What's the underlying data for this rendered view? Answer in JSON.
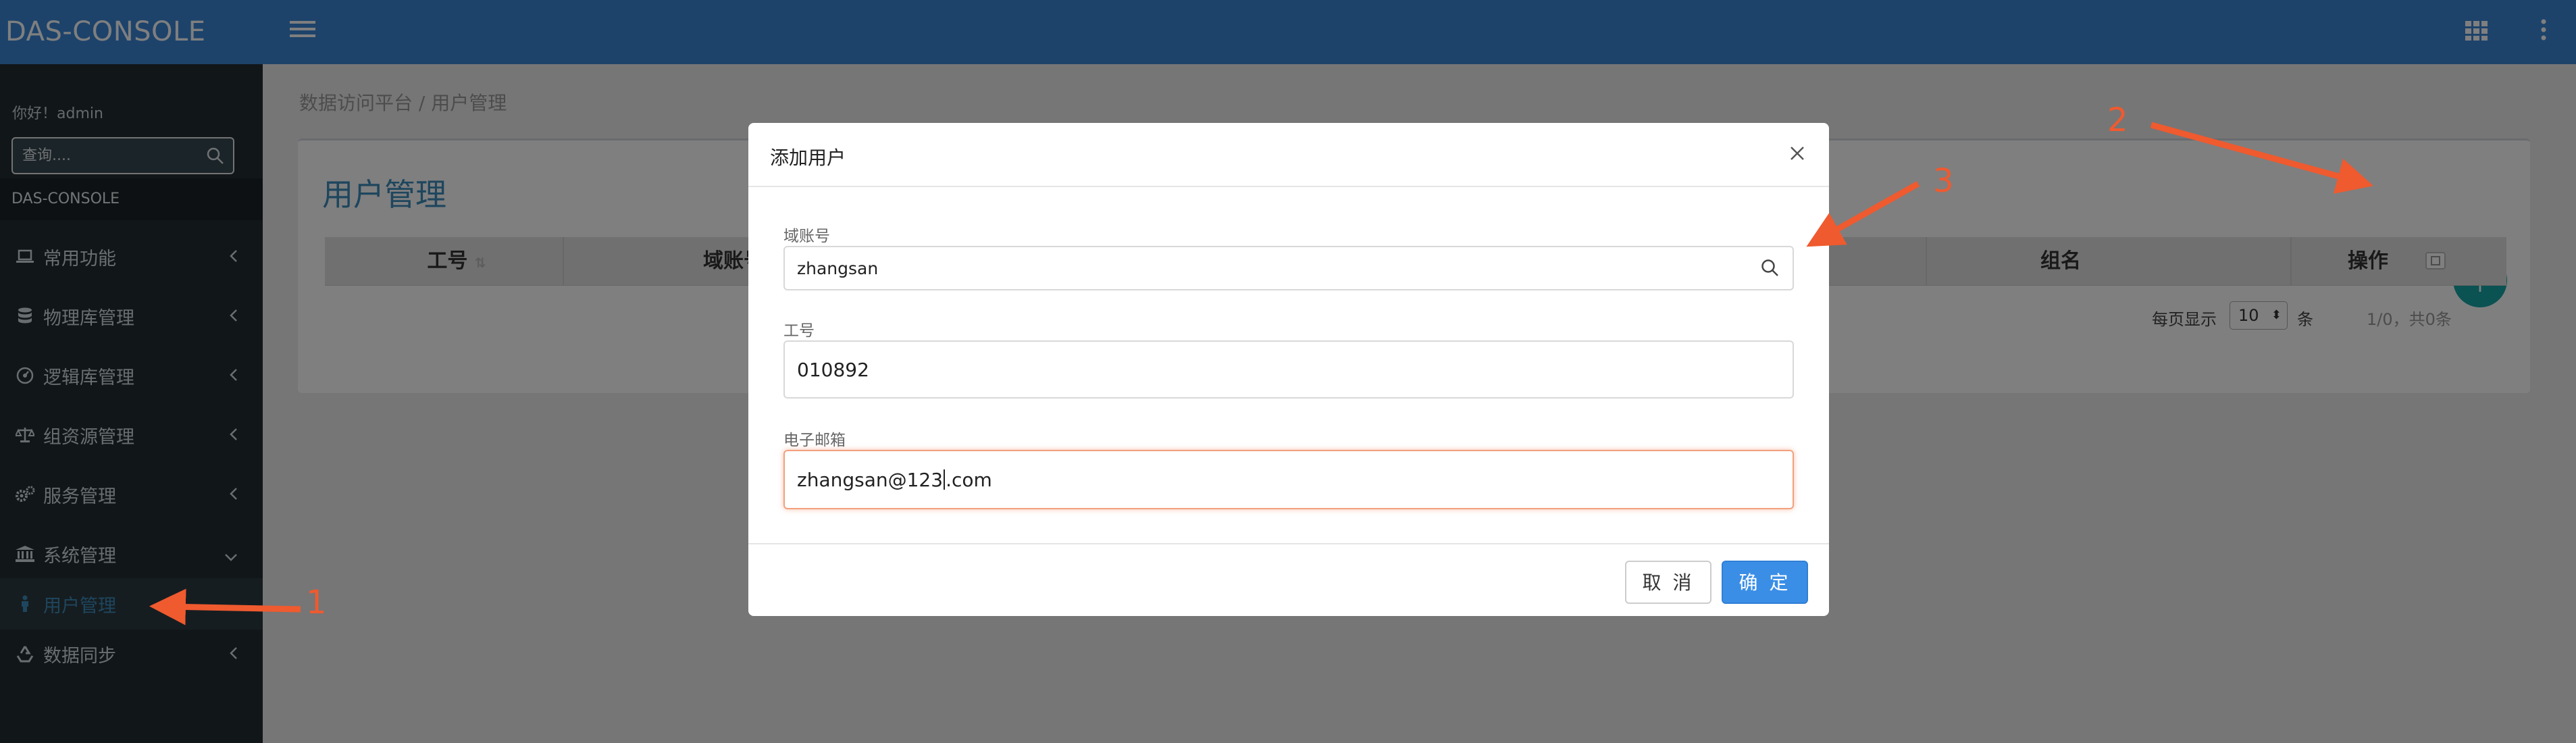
{
  "app": {
    "brand": "DAS-CONSOLE"
  },
  "sidebar": {
    "greeting": "你好！admin",
    "search_placeholder": "查询....",
    "header": "DAS-CONSOLE",
    "items": [
      {
        "label": "常用功能",
        "icon": "laptop-icon"
      },
      {
        "label": "物理库管理",
        "icon": "database-icon"
      },
      {
        "label": "逻辑库管理",
        "icon": "dashboard-icon"
      },
      {
        "label": "组资源管理",
        "icon": "balance-scale-icon"
      },
      {
        "label": "服务管理",
        "icon": "cogs-icon"
      },
      {
        "label": "系统管理",
        "icon": "bank-icon"
      },
      {
        "label": "用户管理",
        "icon": "person-icon"
      },
      {
        "label": "数据同步",
        "icon": "recycle-icon"
      }
    ]
  },
  "content": {
    "breadcrumb": "数据访问平台 / 用户管理",
    "title": "用户管理",
    "columns": [
      "工号",
      "域账号",
      "组名",
      "操作"
    ],
    "pager": {
      "per_page_label": "每页显示",
      "per_page_value": "10",
      "unit": "条",
      "summary": "1/0，共0条"
    }
  },
  "modal": {
    "title": "添加用户",
    "fields": [
      {
        "label": "域账号",
        "value": "zhangsan"
      },
      {
        "label": "工号",
        "value": "010892"
      },
      {
        "label": "电子邮箱",
        "value_before_caret": "zhangsan@123",
        "value_after_caret": ".com"
      }
    ],
    "cancel_label": "取 消",
    "ok_label": "确 定"
  },
  "annotations": {
    "n1": "1",
    "n2": "2",
    "n3": "3",
    "color": "#ef5a2f"
  },
  "colors": {
    "primary": "#3a87d6",
    "sidebar_bg": "#222d32",
    "fab": "#16a4a6",
    "ok_button": "#3a8ee6"
  }
}
